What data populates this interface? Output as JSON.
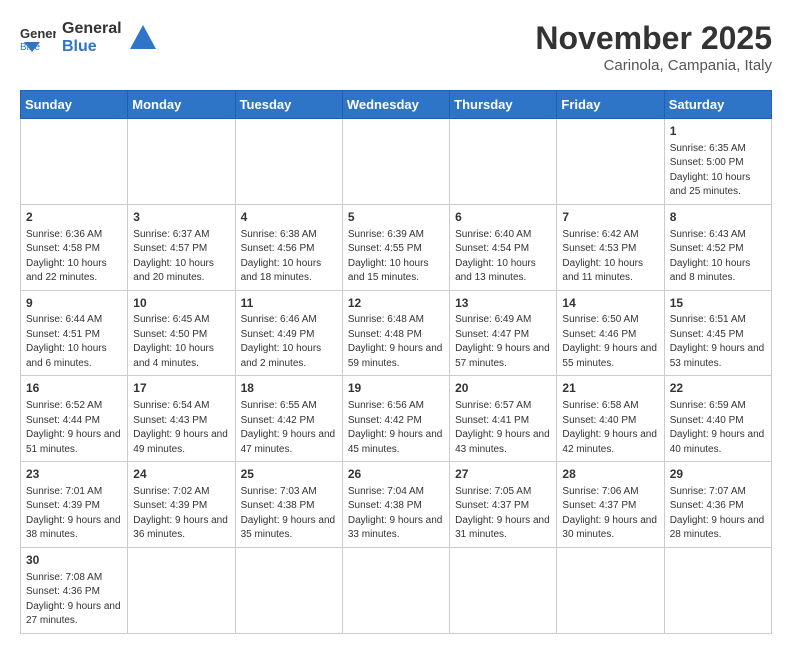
{
  "header": {
    "logo_general": "General",
    "logo_blue": "Blue",
    "month_title": "November 2025",
    "location": "Carinola, Campania, Italy"
  },
  "weekdays": [
    "Sunday",
    "Monday",
    "Tuesday",
    "Wednesday",
    "Thursday",
    "Friday",
    "Saturday"
  ],
  "weeks": [
    [
      {
        "day": "",
        "info": ""
      },
      {
        "day": "",
        "info": ""
      },
      {
        "day": "",
        "info": ""
      },
      {
        "day": "",
        "info": ""
      },
      {
        "day": "",
        "info": ""
      },
      {
        "day": "",
        "info": ""
      },
      {
        "day": "1",
        "info": "Sunrise: 6:35 AM\nSunset: 5:00 PM\nDaylight: 10 hours and 25 minutes."
      }
    ],
    [
      {
        "day": "2",
        "info": "Sunrise: 6:36 AM\nSunset: 4:58 PM\nDaylight: 10 hours and 22 minutes."
      },
      {
        "day": "3",
        "info": "Sunrise: 6:37 AM\nSunset: 4:57 PM\nDaylight: 10 hours and 20 minutes."
      },
      {
        "day": "4",
        "info": "Sunrise: 6:38 AM\nSunset: 4:56 PM\nDaylight: 10 hours and 18 minutes."
      },
      {
        "day": "5",
        "info": "Sunrise: 6:39 AM\nSunset: 4:55 PM\nDaylight: 10 hours and 15 minutes."
      },
      {
        "day": "6",
        "info": "Sunrise: 6:40 AM\nSunset: 4:54 PM\nDaylight: 10 hours and 13 minutes."
      },
      {
        "day": "7",
        "info": "Sunrise: 6:42 AM\nSunset: 4:53 PM\nDaylight: 10 hours and 11 minutes."
      },
      {
        "day": "8",
        "info": "Sunrise: 6:43 AM\nSunset: 4:52 PM\nDaylight: 10 hours and 8 minutes."
      }
    ],
    [
      {
        "day": "9",
        "info": "Sunrise: 6:44 AM\nSunset: 4:51 PM\nDaylight: 10 hours and 6 minutes."
      },
      {
        "day": "10",
        "info": "Sunrise: 6:45 AM\nSunset: 4:50 PM\nDaylight: 10 hours and 4 minutes."
      },
      {
        "day": "11",
        "info": "Sunrise: 6:46 AM\nSunset: 4:49 PM\nDaylight: 10 hours and 2 minutes."
      },
      {
        "day": "12",
        "info": "Sunrise: 6:48 AM\nSunset: 4:48 PM\nDaylight: 9 hours and 59 minutes."
      },
      {
        "day": "13",
        "info": "Sunrise: 6:49 AM\nSunset: 4:47 PM\nDaylight: 9 hours and 57 minutes."
      },
      {
        "day": "14",
        "info": "Sunrise: 6:50 AM\nSunset: 4:46 PM\nDaylight: 9 hours and 55 minutes."
      },
      {
        "day": "15",
        "info": "Sunrise: 6:51 AM\nSunset: 4:45 PM\nDaylight: 9 hours and 53 minutes."
      }
    ],
    [
      {
        "day": "16",
        "info": "Sunrise: 6:52 AM\nSunset: 4:44 PM\nDaylight: 9 hours and 51 minutes."
      },
      {
        "day": "17",
        "info": "Sunrise: 6:54 AM\nSunset: 4:43 PM\nDaylight: 9 hours and 49 minutes."
      },
      {
        "day": "18",
        "info": "Sunrise: 6:55 AM\nSunset: 4:42 PM\nDaylight: 9 hours and 47 minutes."
      },
      {
        "day": "19",
        "info": "Sunrise: 6:56 AM\nSunset: 4:42 PM\nDaylight: 9 hours and 45 minutes."
      },
      {
        "day": "20",
        "info": "Sunrise: 6:57 AM\nSunset: 4:41 PM\nDaylight: 9 hours and 43 minutes."
      },
      {
        "day": "21",
        "info": "Sunrise: 6:58 AM\nSunset: 4:40 PM\nDaylight: 9 hours and 42 minutes."
      },
      {
        "day": "22",
        "info": "Sunrise: 6:59 AM\nSunset: 4:40 PM\nDaylight: 9 hours and 40 minutes."
      }
    ],
    [
      {
        "day": "23",
        "info": "Sunrise: 7:01 AM\nSunset: 4:39 PM\nDaylight: 9 hours and 38 minutes."
      },
      {
        "day": "24",
        "info": "Sunrise: 7:02 AM\nSunset: 4:39 PM\nDaylight: 9 hours and 36 minutes."
      },
      {
        "day": "25",
        "info": "Sunrise: 7:03 AM\nSunset: 4:38 PM\nDaylight: 9 hours and 35 minutes."
      },
      {
        "day": "26",
        "info": "Sunrise: 7:04 AM\nSunset: 4:38 PM\nDaylight: 9 hours and 33 minutes."
      },
      {
        "day": "27",
        "info": "Sunrise: 7:05 AM\nSunset: 4:37 PM\nDaylight: 9 hours and 31 minutes."
      },
      {
        "day": "28",
        "info": "Sunrise: 7:06 AM\nSunset: 4:37 PM\nDaylight: 9 hours and 30 minutes."
      },
      {
        "day": "29",
        "info": "Sunrise: 7:07 AM\nSunset: 4:36 PM\nDaylight: 9 hours and 28 minutes."
      }
    ],
    [
      {
        "day": "30",
        "info": "Sunrise: 7:08 AM\nSunset: 4:36 PM\nDaylight: 9 hours and 27 minutes."
      },
      {
        "day": "",
        "info": ""
      },
      {
        "day": "",
        "info": ""
      },
      {
        "day": "",
        "info": ""
      },
      {
        "day": "",
        "info": ""
      },
      {
        "day": "",
        "info": ""
      },
      {
        "day": "",
        "info": ""
      }
    ]
  ]
}
